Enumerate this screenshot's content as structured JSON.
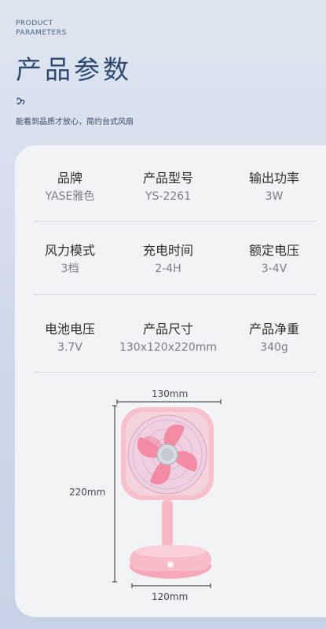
{
  "header": {
    "en_line1": "PRODUCT",
    "en_line2": "PARAMETERS",
    "title": "产品参数",
    "subtitle": "能看到品质才放心，简约台式风扇"
  },
  "specs": [
    {
      "label": "品牌",
      "value": "YASE雅色"
    },
    {
      "label": "产品型号",
      "value": "YS-2261"
    },
    {
      "label": "输出功率",
      "value": "3W"
    },
    {
      "label": "风力模式",
      "value": "3档"
    },
    {
      "label": "充电时间",
      "value": "2-4H"
    },
    {
      "label": "额定电压",
      "value": "3-4V"
    },
    {
      "label": "电池电压",
      "value": "3.7V"
    },
    {
      "label": "产品尺寸",
      "value": "130x120x220mm"
    },
    {
      "label": "产品净重",
      "value": "340g"
    }
  ],
  "dimensions": {
    "top_width": "130mm",
    "height": "220mm",
    "base_width": "120mm"
  },
  "colors": {
    "title": "#2f4a72",
    "fan_pink": "#f6b9c6",
    "blade_pink": "#f08aa0"
  }
}
